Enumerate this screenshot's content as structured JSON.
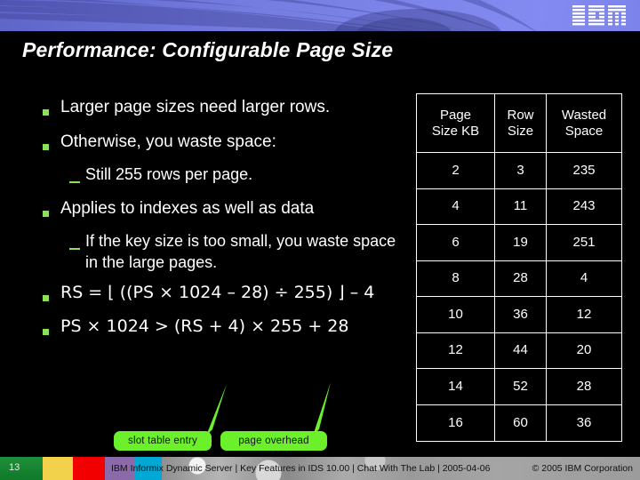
{
  "header": {
    "logo": "ibm-logo",
    "logo_text": "IBM"
  },
  "title": "Performance: Configurable Page Size",
  "bullets": [
    {
      "level": 1,
      "marker": "square",
      "text": "Larger page sizes need larger rows."
    },
    {
      "level": 1,
      "marker": "square",
      "text": "Otherwise, you waste space:"
    },
    {
      "level": 2,
      "marker": "dash",
      "text": "Still 255 rows per page."
    },
    {
      "level": 1,
      "marker": "square",
      "text": "Applies to indexes as well as data"
    },
    {
      "level": 2,
      "marker": "dash",
      "text": "If the key size is too small, you waste space in the large pages."
    },
    {
      "level": 1,
      "marker": "square",
      "text": "RS = ⌊ ((PS × 1024 – 28) ÷ 255) ⌋ – 4"
    },
    {
      "level": 1,
      "marker": "square",
      "text": "PS × 1024 > (RS + 4) × 255 + 28"
    }
  ],
  "table": {
    "headers": [
      "Page Size KB",
      "Row Size",
      "Wasted Space"
    ],
    "header_lines": [
      [
        "Page",
        "Size KB"
      ],
      [
        "Row",
        "Size"
      ],
      [
        "Wasted",
        "Space"
      ]
    ],
    "rows": [
      [
        "2",
        "3",
        "235"
      ],
      [
        "4",
        "11",
        "243"
      ],
      [
        "6",
        "19",
        "251"
      ],
      [
        "8",
        "28",
        "4"
      ],
      [
        "10",
        "36",
        "12"
      ],
      [
        "12",
        "44",
        "20"
      ],
      [
        "14",
        "52",
        "28"
      ],
      [
        "16",
        "60",
        "36"
      ]
    ]
  },
  "callouts": [
    {
      "label": "slot table entry"
    },
    {
      "label": "page overhead"
    }
  ],
  "footer": {
    "page_number": "13",
    "center_text": "IBM Informix Dynamic Server  | Key Features in IDS 10.00  |  Chat With The Lab  |  2005-04-06",
    "copyright": "© 2005 IBM Corporation"
  },
  "colors": {
    "banner_blue": "#7a82e8",
    "bullet_green": "#8ce05c",
    "callout_green": "#6cf02c",
    "background": "#000000",
    "text": "#ffffff",
    "footer_gray": "#9d9d9d"
  }
}
